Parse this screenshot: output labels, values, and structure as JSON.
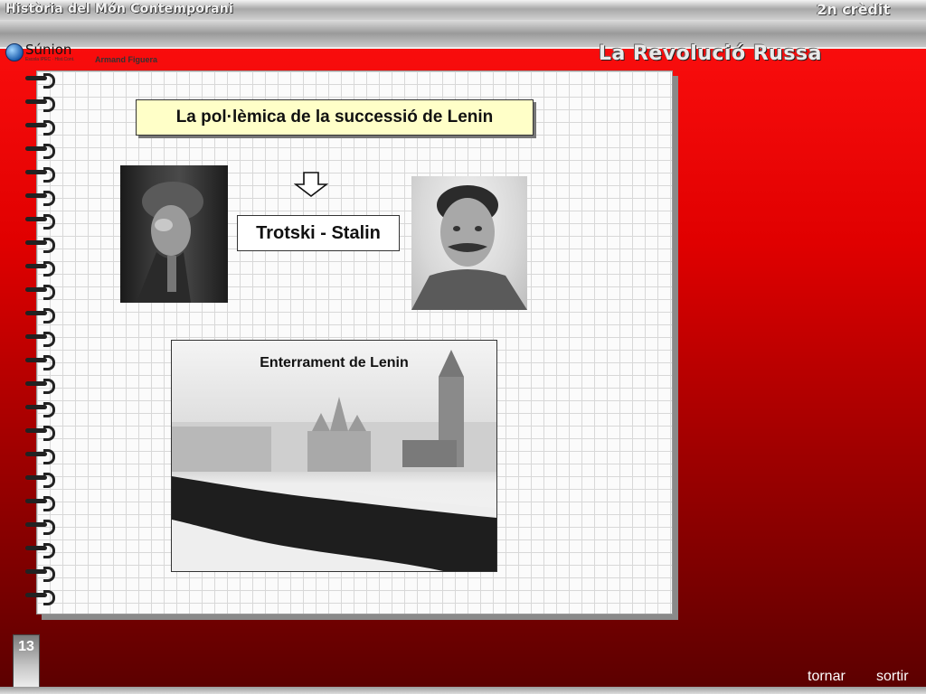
{
  "header": {
    "course": "Història del Món Contemporani",
    "credit": "2n crèdit",
    "unit_title": "La Revolució Russa",
    "logo": "Súnion",
    "logo_sub": "Escola IPEC · Hist.Cont.",
    "author": "Armand Figuera"
  },
  "slide": {
    "title": "La pol·lèmica de la successió de Lenin",
    "subtitle": "Trotski - Stalin",
    "photo_caption": "Enterrament de Lenin"
  },
  "footer": {
    "page_number": "13",
    "back_label": "tornar",
    "exit_label": "sortir"
  },
  "icons": {
    "arrow": "arrow-down-icon",
    "globe": "globe-icon"
  },
  "colors": {
    "background_top": "#ff1010",
    "background_bottom": "#5a0000",
    "title_box": "#ffffc8"
  }
}
